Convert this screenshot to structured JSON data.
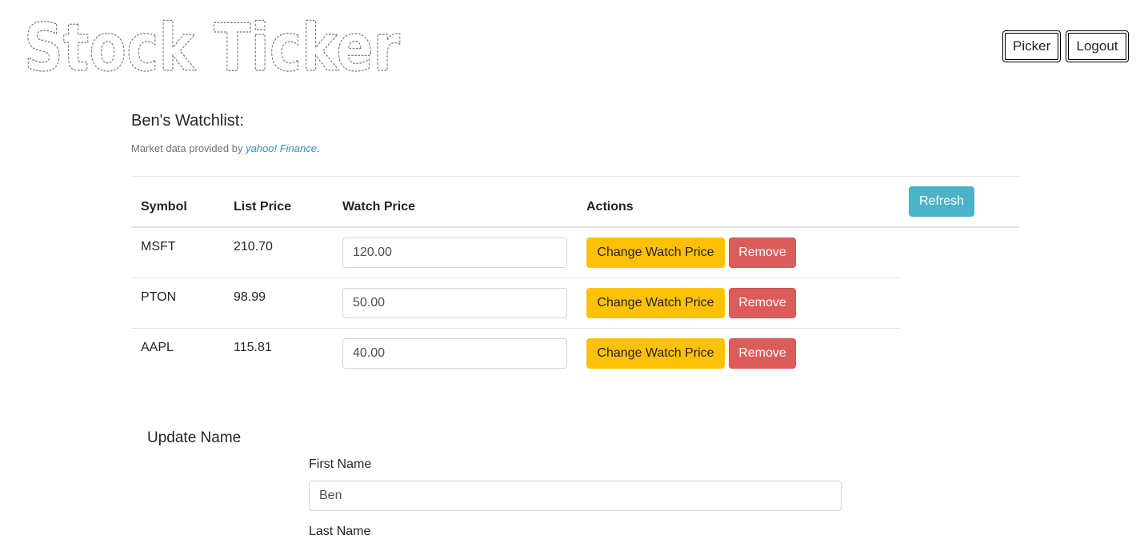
{
  "logo": {
    "text": "Stock Ticker"
  },
  "nav": {
    "picker_label": "Picker",
    "logout_label": "Logout"
  },
  "watchlist": {
    "title": "Ben's Watchlist:",
    "attribution_prefix": "Market data provided by ",
    "attribution_brand": "yahoo! Finance",
    "attribution_suffix": ".",
    "headers": {
      "symbol": "Symbol",
      "list_price": "List Price",
      "watch_price": "Watch Price",
      "actions": "Actions"
    },
    "refresh_label": "Refresh",
    "change_label": "Change Watch Price",
    "remove_label": "Remove",
    "rows": [
      {
        "symbol": "MSFT",
        "list_price": "210.70",
        "watch_price": "120.00"
      },
      {
        "symbol": "PTON",
        "list_price": "98.99",
        "watch_price": "50.00"
      },
      {
        "symbol": "AAPL",
        "list_price": "115.81",
        "watch_price": "40.00"
      }
    ]
  },
  "update_name": {
    "title": "Update Name",
    "first_name_label": "First Name",
    "first_name_value": "Ben",
    "last_name_label": "Last Name"
  }
}
